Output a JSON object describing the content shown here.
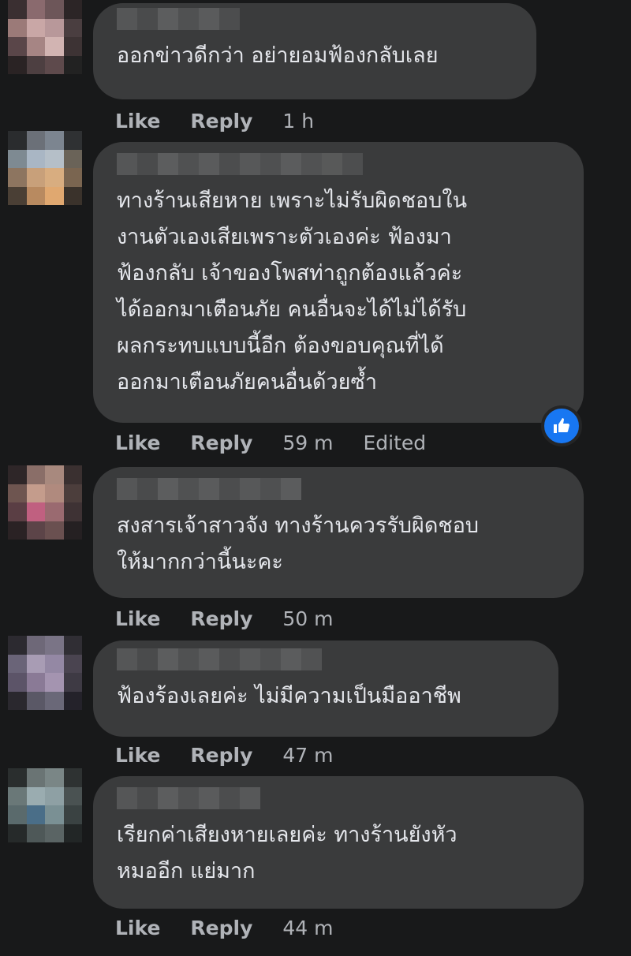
{
  "comments": [
    {
      "text": "ออกข่าวดีกว่า อย่ายอมฟ้องกลับเลย",
      "actions": {
        "like": "Like",
        "reply": "Reply",
        "time": "1 h"
      }
    },
    {
      "text": "ทางร้านเสียหาย เพราะไม่รับผิดชอบใน\nงานตัวเองเสียเพราะตัวเองค่ะ ฟ้องมา\nฟ้องกลับ เจ้าของโพสท่าถูกต้องแล้วค่ะ\nได้ออกมาเตือนภัย คนอื่นจะได้ไม่ได้รับ\nผลกระทบแบบนี้อีก ต้องขอบคุณที่ได้\nออกมาเตือนภัยคนอื่นด้วยซ้ำ",
      "actions": {
        "like": "Like",
        "reply": "Reply",
        "time": "59 m",
        "edited": "Edited"
      },
      "reaction_icon": "like-reaction-icon"
    },
    {
      "text": "สงสารเจ้าสาวจัง ทางร้านควรรับผิดชอบ\nให้มากกว่านี้นะคะ",
      "actions": {
        "like": "Like",
        "reply": "Reply",
        "time": "50 m"
      }
    },
    {
      "text": "ฟ้องร้องเลยค่ะ ไม่มีความเป็นมืออาชีพ",
      "actions": {
        "like": "Like",
        "reply": "Reply",
        "time": "47 m"
      }
    },
    {
      "text": "เรียกค่าเสียงหายเลยค่ะ ทางร้านยังหัว\nหมออีก แย่มาก",
      "actions": {
        "like": "Like",
        "reply": "Reply",
        "time": "44 m"
      }
    }
  ],
  "colors": {
    "background": "#18191a",
    "bubble": "#3a3b3c",
    "text": "#e4e6eb",
    "secondary_text": "#b0b3b8",
    "like_blue": "#1877f2"
  }
}
